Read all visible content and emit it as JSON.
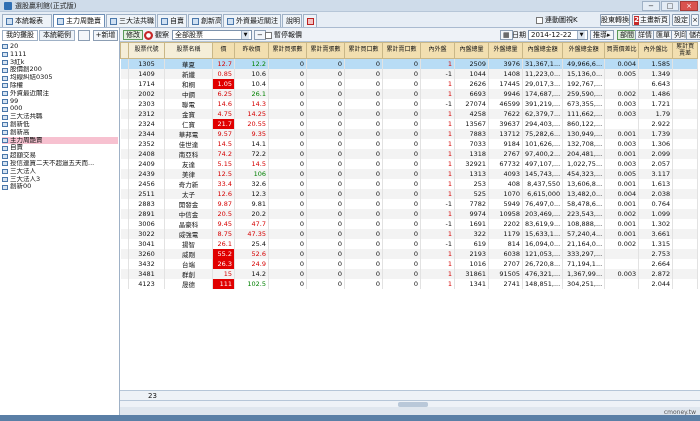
{
  "window": {
    "title": "選股贏利館(正式版)",
    "controls": [
      "−",
      "□",
      "×"
    ]
  },
  "tabs": [
    {
      "label": "本統報表",
      "icon": "grid-icon"
    },
    {
      "label": "主力周艷賣",
      "icon": "grid-icon",
      "active": true
    },
    {
      "label": "三大法共職",
      "icon": "grid-icon"
    },
    {
      "label": "自賣",
      "icon": "grid-icon"
    },
    {
      "label": "創新高",
      "icon": "grid-icon"
    },
    {
      "label": "外資最近關注",
      "icon": "grid-icon"
    },
    {
      "label": "說明",
      "icon": ""
    },
    {
      "label": "",
      "icon": "flag-icon"
    }
  ],
  "topbar": {
    "auto_refresh_label": "連動圖視K",
    "refresh_button": "股東轉換",
    "plan_badge": "2",
    "plan_button": "主畫新頁",
    "settings_button": "設定"
  },
  "left": {
    "tabs": [
      "我的攤股",
      "本統範例"
    ],
    "add_button": "新增",
    "items": [
      "20",
      "1111",
      "3紅k",
      "股價創200",
      "均線糾結0305",
      "除權",
      "外資最近關注",
      "99",
      "000",
      "三大法共職",
      "創新低",
      "創新高",
      "主力周艷賣",
      "自賣",
      "超額交易",
      "投信連買二天不超過五天而...",
      "三大法人",
      "三大法人3",
      "創新00"
    ],
    "selected_index": 12
  },
  "toolbar": {
    "edit_label": "修改",
    "group_label": "觀察",
    "group_value": "全部股票",
    "pause_label": "暫停報價",
    "date_label": "日期",
    "date_value": "2014-12-22",
    "next_label": "推導",
    "buttons": [
      "部間",
      "詳情",
      "匯單",
      "列印",
      "儲存"
    ]
  },
  "table": {
    "headers": [
      "股票代號",
      "股票名稱",
      "價",
      "昨收價",
      "累計買張數",
      "累計賣張數",
      "累計買口數",
      "累計賣口數",
      "內外盤",
      "內盤總量",
      "外盤總量",
      "內盤總金額",
      "外盤總金額",
      "買賣價差比",
      "內外盤比",
      "累計買賣差"
    ],
    "rows": [
      [
        "1305",
        "華夏",
        "12.7",
        "12.2",
        "0",
        "0",
        "0",
        "0",
        "1",
        "2509",
        "3976",
        "31,367,1...",
        "49,966,6...",
        "0.004",
        "1.585",
        ""
      ],
      [
        "1409",
        "新纖",
        "0.85",
        "10.6",
        "0",
        "0",
        "0",
        "0",
        "-1",
        "1044",
        "1408",
        "11,223,0...",
        "15,136,0...",
        "0.005",
        "1.349",
        ""
      ],
      [
        "1714",
        "和桐",
        "1.05",
        "10.4",
        "0",
        "0",
        "0",
        "0",
        "1",
        "2626",
        "17445",
        "29,017,3...",
        "192,767,...",
        "",
        "6.643",
        ""
      ],
      [
        "2002",
        "中鋼",
        "6.25",
        "26.1",
        "0",
        "0",
        "0",
        "0",
        "1",
        "6693",
        "9946",
        "174,687,...",
        "259,590,...",
        "0.002",
        "1.486",
        ""
      ],
      [
        "2303",
        "聯電",
        "14.6",
        "14.3",
        "0",
        "0",
        "0",
        "0",
        "-1",
        "27074",
        "46599",
        "391,219,...",
        "673,355,...",
        "0.003",
        "1.721",
        ""
      ],
      [
        "2312",
        "金寶",
        "4.75",
        "14.25",
        "0",
        "0",
        "0",
        "0",
        "1",
        "4258",
        "7622",
        "62,379,7...",
        "111,662,...",
        "0.003",
        "1.79",
        ""
      ],
      [
        "2324",
        "仁寶",
        "21.7",
        "20.55",
        "0",
        "0",
        "0",
        "0",
        "1",
        "13567",
        "39637",
        "294,403,...",
        "860,122,...",
        "",
        "2.922",
        ""
      ],
      [
        "2344",
        "華邦電",
        "9.57",
        "9.35",
        "0",
        "0",
        "0",
        "0",
        "1",
        "7883",
        "13712",
        "75,282,6...",
        "130,949,...",
        "0.001",
        "1.739",
        ""
      ],
      [
        "2352",
        "佳世達",
        "14.5",
        "14.1",
        "0",
        "0",
        "0",
        "0",
        "1",
        "7033",
        "9184",
        "101,626,...",
        "132,708,...",
        "0.003",
        "1.306",
        ""
      ],
      [
        "2408",
        "南亞科",
        "74.2",
        "72.2",
        "0",
        "0",
        "0",
        "0",
        "1",
        "1318",
        "2767",
        "97,400,2...",
        "204,481,...",
        "0.001",
        "2.099",
        ""
      ],
      [
        "2409",
        "友達",
        "5.15",
        "14.5",
        "0",
        "0",
        "0",
        "0",
        "1",
        "32921",
        "67732",
        "497,107,...",
        "1,022,75...",
        "0.003",
        "2.057",
        ""
      ],
      [
        "2439",
        "美律",
        "12.5",
        "106",
        "0",
        "0",
        "0",
        "0",
        "1",
        "1313",
        "4093",
        "145,743,...",
        "454,323,...",
        "0.005",
        "3.117",
        ""
      ],
      [
        "2456",
        "奇力新",
        "33.4",
        "32.6",
        "0",
        "0",
        "0",
        "0",
        "1",
        "253",
        "408",
        "8,437,550",
        "13,606,8...",
        "0.001",
        "1.613",
        ""
      ],
      [
        "2511",
        "太子",
        "12.6",
        "12.3",
        "0",
        "0",
        "0",
        "0",
        "1",
        "525",
        "1070",
        "6,615,000",
        "13,482,0...",
        "0.004",
        "2.038",
        ""
      ],
      [
        "2883",
        "開發金",
        "9.87",
        "9.81",
        "0",
        "0",
        "0",
        "0",
        "-1",
        "7782",
        "5949",
        "76,497,0...",
        "58,478,6...",
        "0.001",
        "0.764",
        ""
      ],
      [
        "2891",
        "中信金",
        "20.5",
        "20.2",
        "0",
        "0",
        "0",
        "0",
        "1",
        "9974",
        "10958",
        "203,469,...",
        "223,543,...",
        "0.002",
        "1.099",
        ""
      ],
      [
        "3006",
        "晶豪科",
        "9.45",
        "47.7",
        "0",
        "0",
        "0",
        "0",
        "-1",
        "1691",
        "2202",
        "83,619,9...",
        "108,888,...",
        "0.001",
        "1.302",
        ""
      ],
      [
        "3022",
        "威強電",
        "8.75",
        "47.35",
        "0",
        "0",
        "0",
        "0",
        "1",
        "322",
        "1179",
        "15,633,1...",
        "57,240,4...",
        "0.001",
        "3.661",
        ""
      ],
      [
        "3041",
        "揚智",
        "26.1",
        "25.4",
        "0",
        "0",
        "0",
        "0",
        "-1",
        "619",
        "814",
        "16,094,0...",
        "21,164,0...",
        "0.002",
        "1.315",
        ""
      ],
      [
        "3260",
        "威剛",
        "55.2",
        "52.6",
        "0",
        "0",
        "0",
        "0",
        "1",
        "2193",
        "6038",
        "121,053,...",
        "333,297,...",
        "",
        "2.753",
        ""
      ],
      [
        "3432",
        "台端",
        "26.3",
        "24.9",
        "0",
        "0",
        "0",
        "0",
        "1",
        "1016",
        "2707",
        "26,720,8...",
        "71,194,1...",
        "",
        "2.664",
        ""
      ],
      [
        "3481",
        "群創",
        "15",
        "14.2",
        "0",
        "0",
        "0",
        "0",
        "1",
        "31861",
        "91505",
        "476,321,...",
        "1,367,99...",
        "0.003",
        "2.872",
        ""
      ],
      [
        "4123",
        "晟德",
        "111",
        "102.5",
        "0",
        "0",
        "0",
        "0",
        "1",
        "1341",
        "2741",
        "148,851,...",
        "304,251,...",
        "",
        "2.044",
        ""
      ]
    ],
    "price_style": [
      "up",
      "up",
      "hi",
      "up",
      "up",
      "up",
      "hi",
      "up",
      "up",
      "up",
      "up",
      "up",
      "up",
      "up",
      "up",
      "up",
      "up",
      "up",
      "up",
      "hi",
      "hi",
      "up",
      "hi"
    ],
    "prev_style": [
      "dn",
      "",
      "",
      "dn",
      "up",
      "up",
      "up",
      "up",
      "",
      "",
      "up",
      "dn",
      "",
      "",
      "",
      "",
      "up",
      "up",
      "",
      "up",
      "up",
      "",
      "dn"
    ],
    "row_count": "23"
  },
  "footer": {
    "watermark": "cmoney.tw"
  }
}
